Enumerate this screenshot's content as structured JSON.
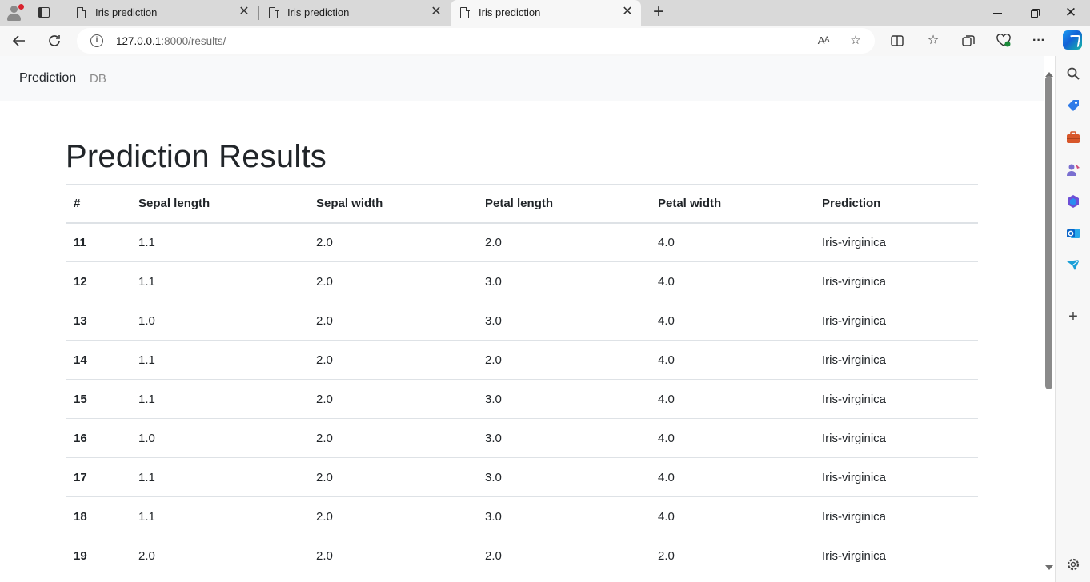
{
  "browser": {
    "tabs": [
      {
        "title": "Iris prediction",
        "active": false
      },
      {
        "title": "Iris prediction",
        "active": false
      },
      {
        "title": "Iris prediction",
        "active": true
      }
    ],
    "url_host": "127.0.0.1",
    "url_rest": ":8000/results/",
    "close_glyph": "✕",
    "new_tab_glyph": "+",
    "info_glyph": "i"
  },
  "navbar": {
    "brand": "Prediction",
    "link_db": "DB"
  },
  "page": {
    "title": "Prediction Results"
  },
  "table": {
    "headers": [
      "#",
      "Sepal length",
      "Sepal width",
      "Petal length",
      "Petal width",
      "Prediction"
    ],
    "rows": [
      [
        "11",
        "1.1",
        "2.0",
        "2.0",
        "4.0",
        "Iris-virginica"
      ],
      [
        "12",
        "1.1",
        "2.0",
        "3.0",
        "4.0",
        "Iris-virginica"
      ],
      [
        "13",
        "1.0",
        "2.0",
        "3.0",
        "4.0",
        "Iris-virginica"
      ],
      [
        "14",
        "1.1",
        "2.0",
        "2.0",
        "4.0",
        "Iris-virginica"
      ],
      [
        "15",
        "1.1",
        "2.0",
        "3.0",
        "4.0",
        "Iris-virginica"
      ],
      [
        "16",
        "1.0",
        "2.0",
        "3.0",
        "4.0",
        "Iris-virginica"
      ],
      [
        "17",
        "1.1",
        "2.0",
        "3.0",
        "4.0",
        "Iris-virginica"
      ],
      [
        "18",
        "1.1",
        "2.0",
        "3.0",
        "4.0",
        "Iris-virginica"
      ],
      [
        "19",
        "2.0",
        "2.0",
        "2.0",
        "2.0",
        "Iris-virginica"
      ]
    ]
  },
  "colors": {
    "navbar_bg": "#f8f9fa",
    "text": "#212529",
    "muted_link": "#8c8c8c",
    "border": "#dee2e6"
  }
}
